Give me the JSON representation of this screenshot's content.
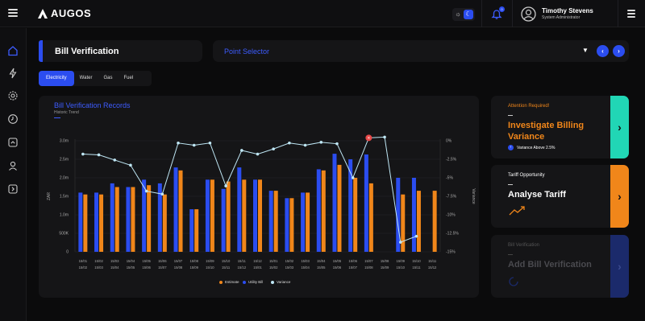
{
  "app": {
    "logo_text": "AUGOS",
    "notification_count": "0",
    "user_name": "Timothy Stevens",
    "user_role": "System Administrator"
  },
  "page": {
    "title": "Bill Verification",
    "point_selector": "Point Selector"
  },
  "tabs": [
    {
      "label": "Electricity",
      "active": true
    },
    {
      "label": "Water",
      "active": false
    },
    {
      "label": "Gas",
      "active": false
    },
    {
      "label": "Fuel",
      "active": false
    }
  ],
  "chart_data": {
    "type": "bar",
    "title": "Bill Verification Records",
    "subtitle": "Historic Trend",
    "ylabel": "ZAR",
    "y2label": "Variance",
    "ylim": [
      0,
      3000000
    ],
    "y2lim": [
      -15,
      0
    ],
    "yticks": [
      "0",
      "500K",
      "1.0m",
      "1.5m",
      "2.0m",
      "2.5m",
      "3.0m"
    ],
    "y2ticks": [
      "0%",
      "-2.5%",
      "-5%",
      "-7.5%",
      "-10%",
      "-12.5%",
      "-15%"
    ],
    "categories": [
      [
        "15/01",
        "15/02"
      ],
      [
        "15/02",
        "15/03"
      ],
      [
        "15/03",
        "15/04"
      ],
      [
        "15/04",
        "15/05"
      ],
      [
        "15/05",
        "15/06"
      ],
      [
        "15/06",
        "15/07"
      ],
      [
        "15/07",
        "15/08"
      ],
      [
        "15/08",
        "15/09"
      ],
      [
        "15/09",
        "15/10"
      ],
      [
        "15/10",
        "15/11"
      ],
      [
        "15/11",
        "15/12"
      ],
      [
        "15/12",
        "15/01"
      ],
      [
        "15/01",
        "15/02"
      ],
      [
        "15/02",
        "15/03"
      ],
      [
        "15/03",
        "15/04"
      ],
      [
        "15/04",
        "15/05"
      ],
      [
        "15/05",
        "15/06"
      ],
      [
        "15/06",
        "15/07"
      ],
      [
        "15/07",
        "15/08"
      ],
      [
        "15/08",
        "15/09"
      ],
      [
        "15/09",
        "15/10"
      ],
      [
        "15/10",
        "15/11"
      ],
      [
        "15/11",
        "15/12"
      ]
    ],
    "series": [
      {
        "name": "Estimate",
        "color": "#f0861a",
        "values": [
          1550000,
          1550000,
          1750000,
          1750000,
          1800000,
          1550000,
          2200000,
          1150000,
          1950000,
          1900000,
          1950000,
          1950000,
          1650000,
          1450000,
          1600000,
          2200000,
          2350000,
          2000000,
          1850000,
          0,
          1550000,
          1650000,
          1650000
        ]
      },
      {
        "name": "Utility Bill",
        "color": "#2b4df0",
        "values": [
          1600000,
          1600000,
          1850000,
          1750000,
          1950000,
          1850000,
          2280000,
          1150000,
          1950000,
          1700000,
          2280000,
          1950000,
          1650000,
          1450000,
          1600000,
          2230000,
          2650000,
          2500000,
          2630000,
          0,
          2000000,
          2000000,
          0
        ]
      },
      {
        "name": "Variance",
        "color": "#bfe7f5",
        "values": [
          -1.8,
          -1.9,
          -2.6,
          -3.3,
          -6.8,
          -7.2,
          -0.3,
          -0.6,
          -0.3,
          -6.1,
          -1.3,
          -1.8,
          -1.1,
          -0.3,
          -0.6,
          -0.2,
          -0.4,
          -5.0,
          0.4,
          0.5,
          -13.7,
          -12.9,
          null
        ]
      }
    ],
    "legend": [
      "Estimate",
      "Utility Bill",
      "Variance"
    ],
    "grid": true
  },
  "cards": [
    {
      "label": "Attention Required!",
      "title_line1": "Investigate Billing",
      "title_line2": "Variance",
      "note": "Variance Above 2.5%",
      "color": "#21d6b5"
    },
    {
      "label": "Tariff Opportunity",
      "title_line1": "Analyse Tariff",
      "title_line2": "",
      "note": "",
      "color": "#f0861a"
    },
    {
      "label": "Bill Verification",
      "title_line1": "Add Bill Verification",
      "title_line2": "",
      "note": "",
      "color": "#1b2a6b"
    }
  ]
}
